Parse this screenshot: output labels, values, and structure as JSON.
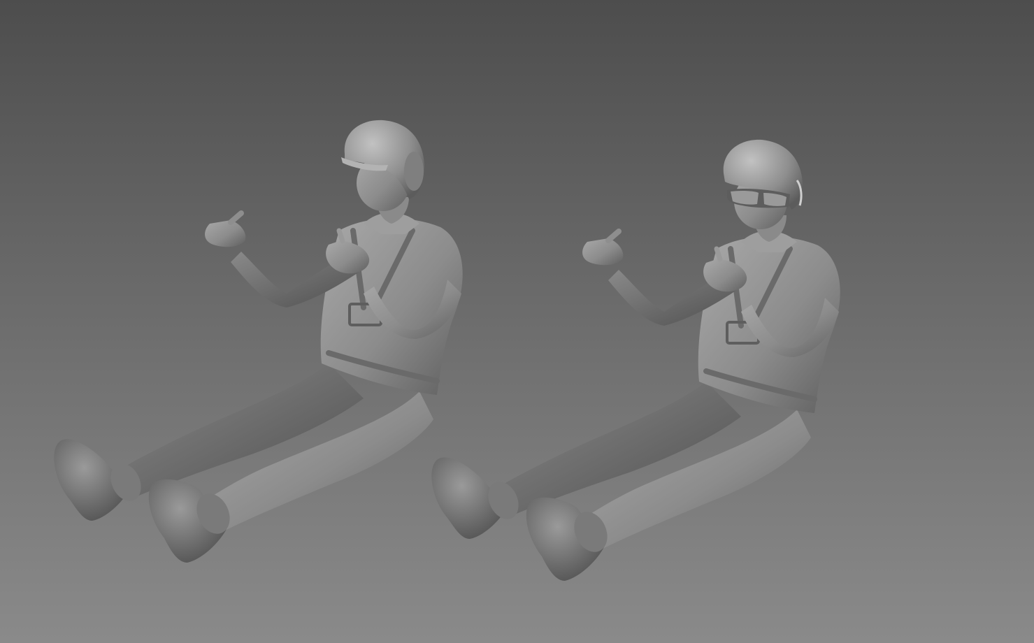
{
  "viewport": {
    "background_top": "#4d4d4d",
    "background_bottom": "#8a8a8a"
  },
  "figures": [
    {
      "id": "driver-figure-left",
      "headgear": "helmet-with-visor",
      "has_goggles": false,
      "material_color": "#8e8e8e"
    },
    {
      "id": "driver-figure-right",
      "headgear": "helmet",
      "has_goggles": true,
      "material_color": "#8e8e8e"
    }
  ]
}
